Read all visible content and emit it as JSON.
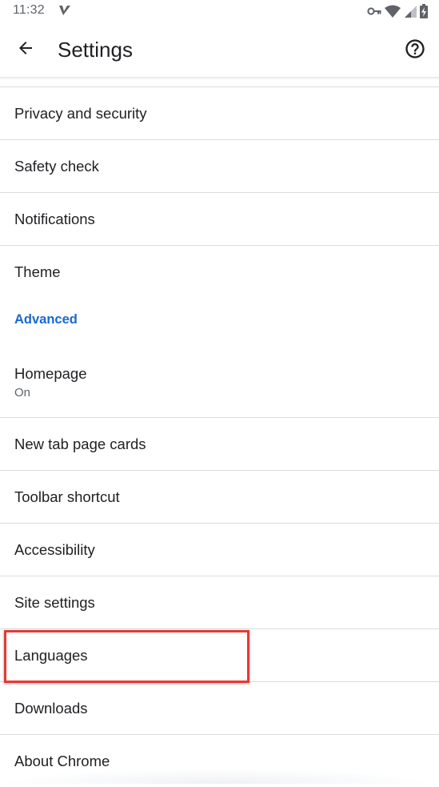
{
  "status_bar": {
    "time": "11:32",
    "icons": [
      "notification-v-icon",
      "vpn-key-icon",
      "wifi-icon",
      "cell-signal-icon",
      "battery-charging-icon"
    ]
  },
  "app_bar": {
    "title": "Settings",
    "back_icon": "arrow-back-icon",
    "help_icon": "help-circle-icon"
  },
  "settings": {
    "items": [
      {
        "label": "Privacy and security"
      },
      {
        "label": "Safety check"
      },
      {
        "label": "Notifications"
      },
      {
        "label": "Theme"
      }
    ],
    "advanced_header": "Advanced",
    "advanced_items": [
      {
        "label": "Homepage",
        "sub": "On"
      },
      {
        "label": "New tab page cards"
      },
      {
        "label": "Toolbar shortcut"
      },
      {
        "label": "Accessibility"
      },
      {
        "label": "Site settings"
      },
      {
        "label": "Languages"
      },
      {
        "label": "Downloads"
      },
      {
        "label": "About Chrome"
      }
    ]
  },
  "colors": {
    "accent": "#1967d2",
    "highlight": "#e53935",
    "divider": "#dadce0",
    "text_primary": "#202124",
    "text_secondary": "#5f6368"
  }
}
